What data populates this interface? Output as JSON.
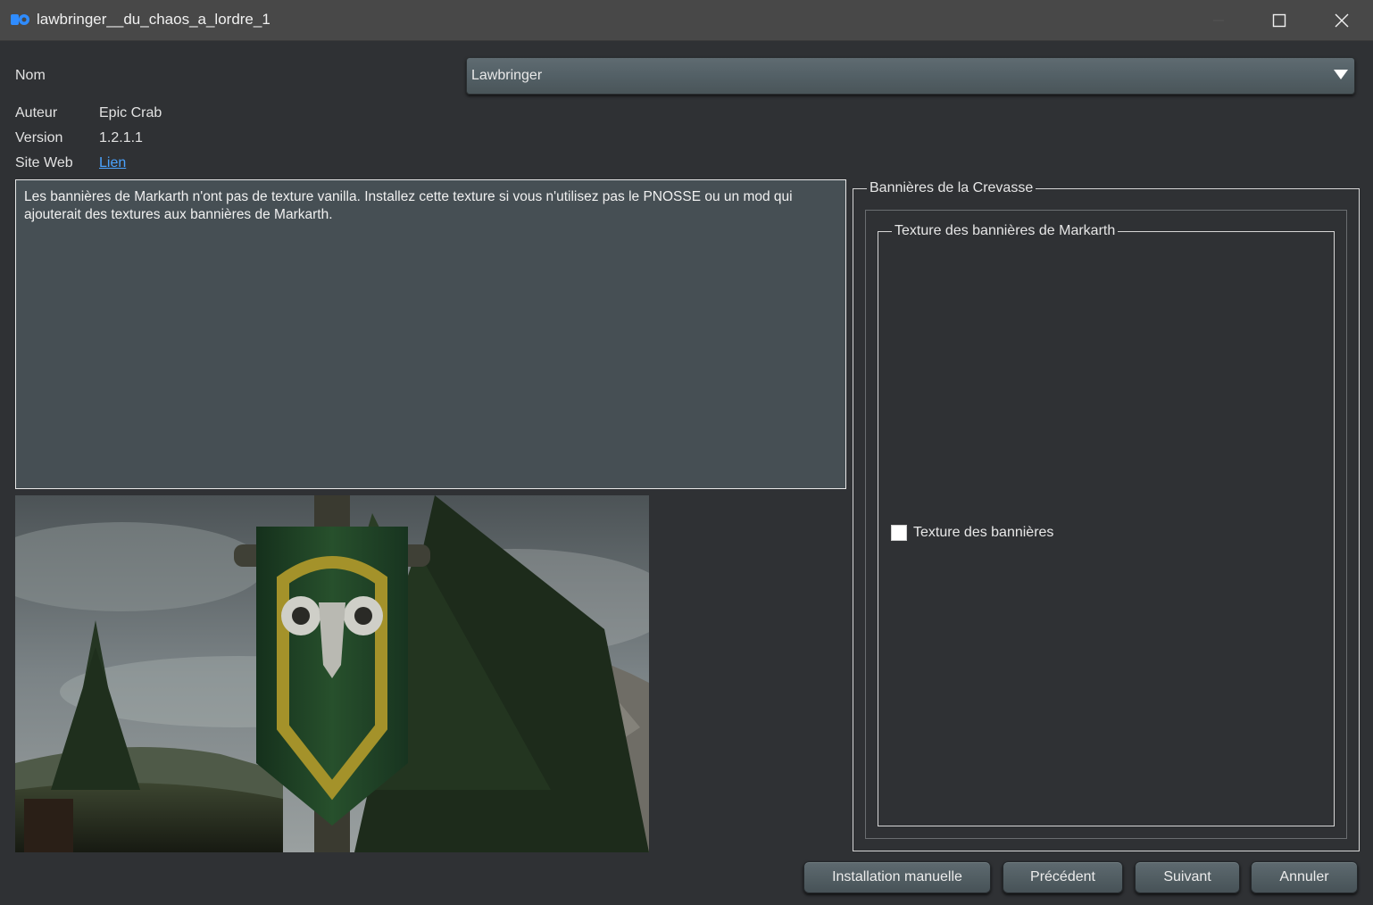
{
  "window": {
    "title": "lawbringer__du_chaos_a_lordre_1"
  },
  "info": {
    "name_label": "Nom",
    "name_value": "Lawbringer",
    "author_label": "Auteur",
    "author_value": "Epic Crab",
    "version_label": "Version",
    "version_value": "1.2.1.1",
    "website_label": "Site Web",
    "website_link": "Lien"
  },
  "description": "Les bannières de Markarth n'ont pas de texture vanilla. Installez cette texture si vous n'utilisez pas le PNOSSE ou un mod qui ajouterait des textures aux bannières de Markarth.",
  "options": {
    "step_title": "Bannières de la Crevasse",
    "group_title": "Texture des bannières de Markarth",
    "items": [
      {
        "label": "Texture des bannières",
        "checked": false
      }
    ]
  },
  "buttons": {
    "manual": "Installation manuelle",
    "previous": "Précédent",
    "next": "Suivant",
    "cancel": "Annuler"
  },
  "colors": {
    "background": "#2f3134",
    "titlebar": "#484848",
    "description_bg": "#464f54",
    "link": "#4aa3ff",
    "app_icon": "#2f8cff"
  },
  "icons": {
    "app": "mod-organizer-icon",
    "minimize": "minimize-icon",
    "maximize": "maximize-icon",
    "close": "close-icon",
    "dropdown": "triangle-down-icon"
  }
}
